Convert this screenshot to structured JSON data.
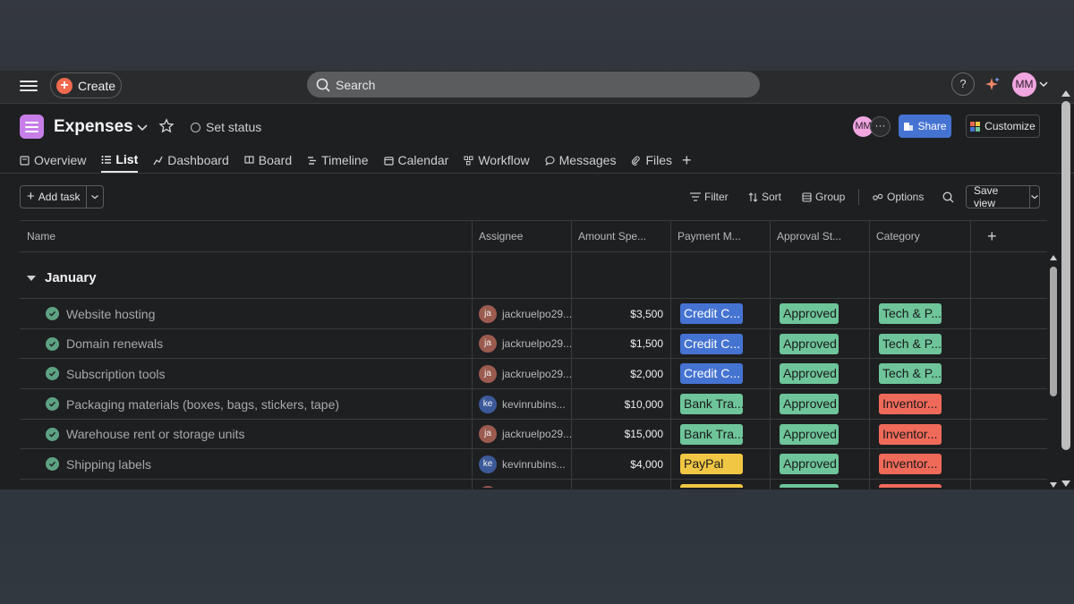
{
  "topbar": {
    "create_label": "Create",
    "search_placeholder": "Search",
    "help_label": "?",
    "user_initials": "MM"
  },
  "header": {
    "title": "Expenses",
    "set_status": "Set status",
    "member_initials": "MM",
    "more_label": "···",
    "share_label": "Share",
    "customize_label": "Customize"
  },
  "tabs": [
    {
      "label": "Overview",
      "icon": "overview-icon",
      "active": false
    },
    {
      "label": "List",
      "icon": "list-icon",
      "active": true
    },
    {
      "label": "Dashboard",
      "icon": "dashboard-icon",
      "active": false
    },
    {
      "label": "Board",
      "icon": "board-icon",
      "active": false
    },
    {
      "label": "Timeline",
      "icon": "timeline-icon",
      "active": false
    },
    {
      "label": "Calendar",
      "icon": "calendar-icon",
      "active": false
    },
    {
      "label": "Workflow",
      "icon": "workflow-icon",
      "active": false
    },
    {
      "label": "Messages",
      "icon": "messages-icon",
      "active": false
    },
    {
      "label": "Files",
      "icon": "files-icon",
      "active": false
    }
  ],
  "toolbar": {
    "add_task_label": "Add task",
    "filter_label": "Filter",
    "sort_label": "Sort",
    "group_label": "Group",
    "options_label": "Options",
    "save_view_label": "Save view"
  },
  "table": {
    "columns": [
      "Name",
      "Assignee",
      "Amount Spe...",
      "Payment M...",
      "Approval St...",
      "Category"
    ],
    "group": "January",
    "rows": [
      {
        "name": "Website hosting",
        "assignee_initials": "ja",
        "assignee": "jackruelpo29...",
        "amount": "$3,500",
        "payment": "Credit C...",
        "approval": "Approved",
        "category": "Tech & P..."
      },
      {
        "name": "Domain renewals",
        "assignee_initials": "ja",
        "assignee": "jackruelpo29...",
        "amount": "$1,500",
        "payment": "Credit C...",
        "approval": "Approved",
        "category": "Tech & P..."
      },
      {
        "name": "Subscription tools",
        "assignee_initials": "ja",
        "assignee": "jackruelpo29...",
        "amount": "$2,000",
        "payment": "Credit C...",
        "approval": "Approved",
        "category": "Tech & P..."
      },
      {
        "name": "Packaging materials (boxes, bags, stickers, tape)",
        "assignee_initials": "ke",
        "assignee": "kevinrubins...",
        "amount": "$10,000",
        "payment": "Bank Tra...",
        "approval": "Approved",
        "category": "Inventor..."
      },
      {
        "name": "Warehouse rent or storage units",
        "assignee_initials": "ja",
        "assignee": "jackruelpo29...",
        "amount": "$15,000",
        "payment": "Bank Tra...",
        "approval": "Approved",
        "category": "Inventor..."
      },
      {
        "name": "Shipping labels",
        "assignee_initials": "ke",
        "assignee": "kevinrubins...",
        "amount": "$4,000",
        "payment": "PayPal",
        "approval": "Approved",
        "category": "Inventor..."
      },
      {
        "name": "",
        "assignee_initials": "",
        "assignee": "",
        "amount": "",
        "payment": "",
        "approval": "",
        "category": ""
      }
    ]
  },
  "colors": {
    "accent": "#4573d2",
    "create": "#f06a4f",
    "complete": "#5da283",
    "tag_credit": "#4573d2",
    "tag_bank": "#6ec59a",
    "tag_paypal": "#f1c644",
    "tag_approved": "#6ec59a",
    "tag_tech": "#6ec59a",
    "tag_inventory": "#f06a5a",
    "avatar_ja": "#9c5b4f",
    "avatar_ke": "#3c5a9a"
  }
}
